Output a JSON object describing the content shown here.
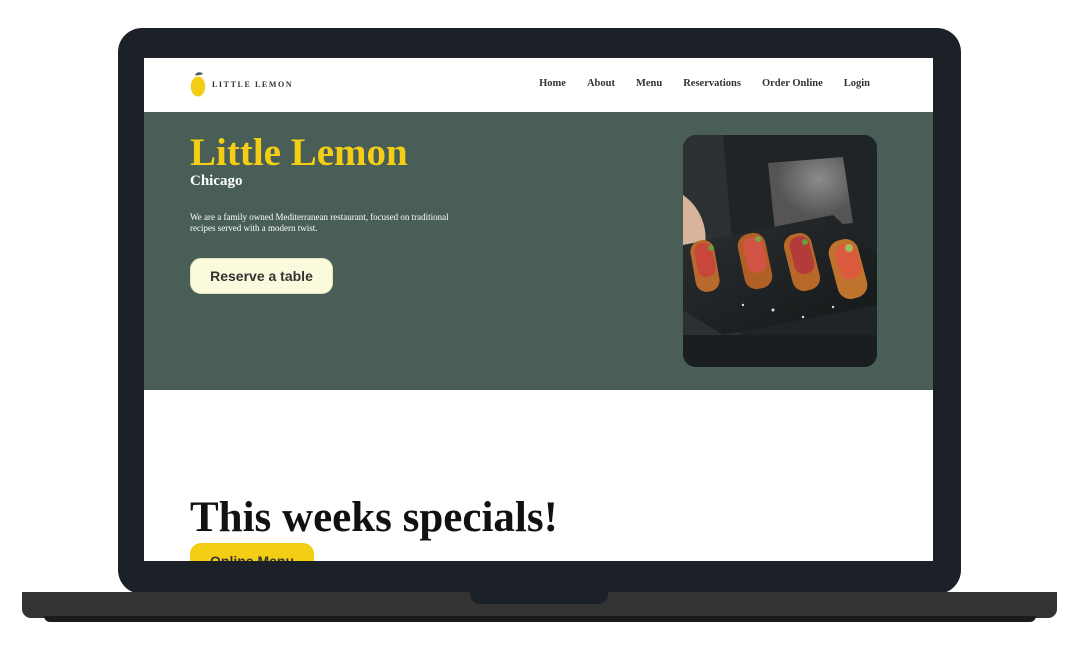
{
  "brand": {
    "name": "LITTLE LEMON",
    "logo_color": "#f4ce14"
  },
  "nav": {
    "items": [
      {
        "label": "Home"
      },
      {
        "label": "About"
      },
      {
        "label": "Menu"
      },
      {
        "label": "Reservations"
      },
      {
        "label": "Order Online"
      },
      {
        "label": "Login"
      }
    ]
  },
  "hero": {
    "title": "Little Lemon",
    "subtitle": "Chicago",
    "description": "We are a family owned Mediterranean restaurant, focused on traditional recipes served with a modern twist.",
    "cta": "Reserve a table",
    "bg_color": "#495e57",
    "title_color": "#f4ce14"
  },
  "specials": {
    "title": "This weeks specials!",
    "cta": "Online Menu",
    "cta_color": "#f4ce14"
  }
}
